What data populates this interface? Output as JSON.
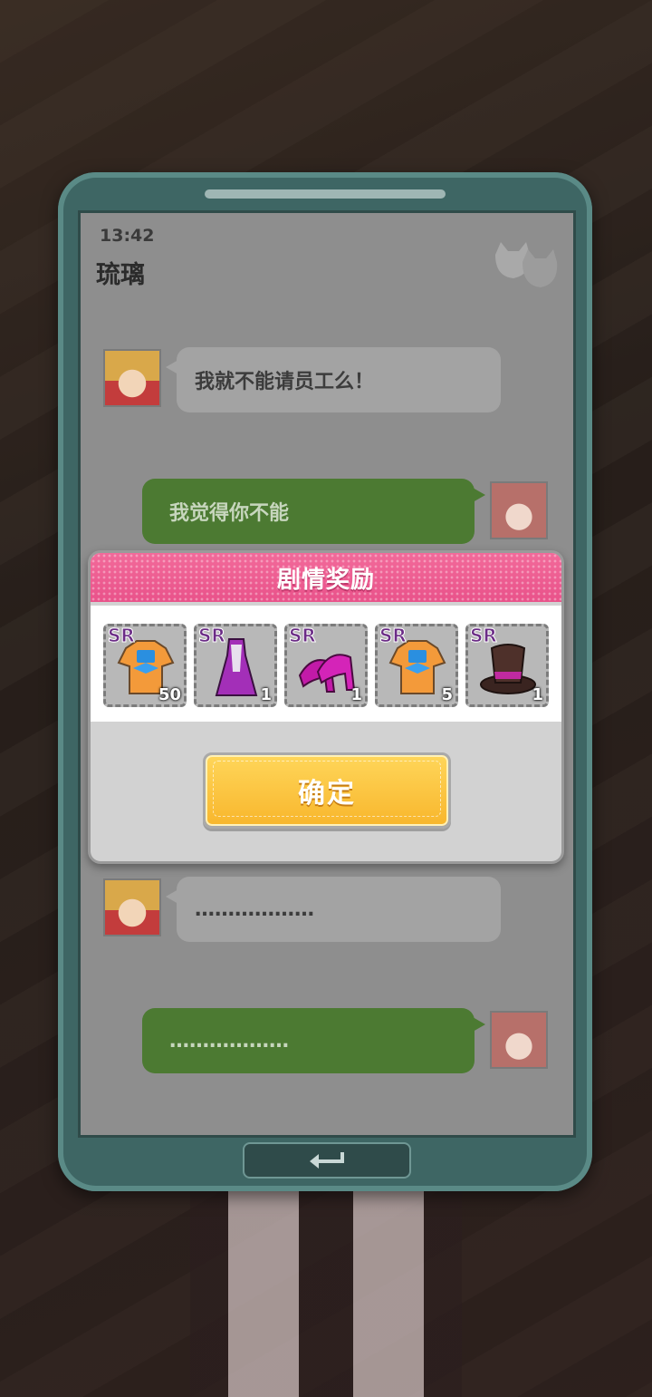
{
  "chat": {
    "time": "13:42",
    "contact_name": "琉璃",
    "messages": [
      {
        "side": "in",
        "text": "我就不能请员工么！"
      },
      {
        "side": "out",
        "text": "我觉得你不能"
      },
      {
        "side": "in",
        "text": "………………"
      },
      {
        "side": "out",
        "text": "………………"
      }
    ]
  },
  "reward_dialog": {
    "title": "剧情奖励",
    "items": [
      {
        "rarity": "SR",
        "icon": "orange-shirt-bowtie-icon",
        "quantity": "50"
      },
      {
        "rarity": "SR",
        "icon": "purple-dress-icon",
        "quantity": "1"
      },
      {
        "rarity": "SR",
        "icon": "magenta-heels-icon",
        "quantity": "1"
      },
      {
        "rarity": "SR",
        "icon": "orange-shirt-bowtie-icon",
        "quantity": "5"
      },
      {
        "rarity": "SR",
        "icon": "brown-top-hat-icon",
        "quantity": "1"
      }
    ],
    "confirm_label": "确定"
  },
  "colors": {
    "phone_frame": "#3e6664",
    "header_pink": "#e9528a",
    "confirm_yellow": "#f8b62c",
    "outgoing_bubble": "#4c7a32"
  }
}
